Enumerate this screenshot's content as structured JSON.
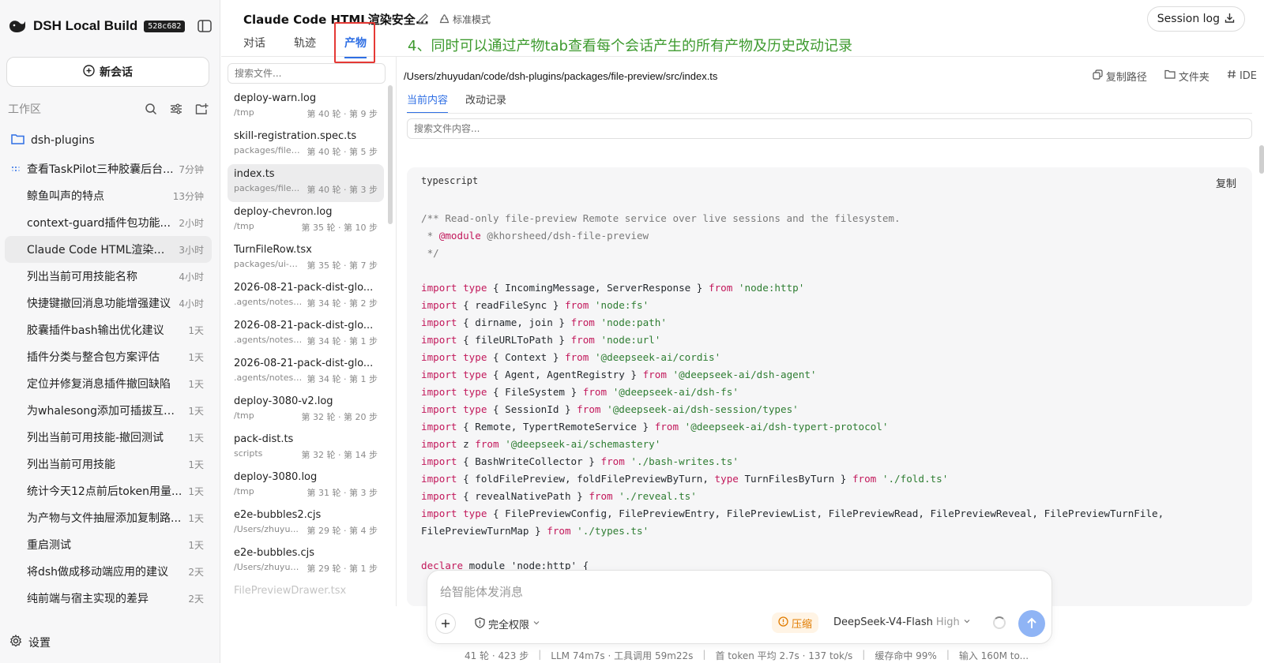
{
  "app": {
    "title": "DSH Local Build",
    "build_id": "528c682"
  },
  "sidebar": {
    "new_chat_label": "新会话",
    "workspace_label": "工作区",
    "folder": "dsh-plugins",
    "sessions": [
      {
        "title": "查看TaskPilot三种胶囊后台...",
        "time": "7分钟",
        "running": true
      },
      {
        "title": "鲸鱼叫声的特点",
        "time": "13分钟"
      },
      {
        "title": "context-guard插件包功能...",
        "time": "2小时"
      },
      {
        "title": "Claude Code HTML渲染安...",
        "time": "3小时",
        "active": true
      },
      {
        "title": "列出当前可用技能名称",
        "time": "4小时"
      },
      {
        "title": "快捷键撤回消息功能增强建议",
        "time": "4小时"
      },
      {
        "title": "胶囊插件bash输出优化建议",
        "time": "1天"
      },
      {
        "title": "插件分类与整合包方案评估",
        "time": "1天"
      },
      {
        "title": "定位并修复消息插件撤回缺陷",
        "time": "1天"
      },
      {
        "title": "为whalesong添加可插拔互动...",
        "time": "1天"
      },
      {
        "title": "列出当前可用技能-撤回测试",
        "time": "1天"
      },
      {
        "title": "列出当前可用技能",
        "time": "1天"
      },
      {
        "title": "统计今天12点前后token用量...",
        "time": "1天"
      },
      {
        "title": "为产物与文件抽屉添加复制路...",
        "time": "1天"
      },
      {
        "title": "重启测试",
        "time": "1天"
      },
      {
        "title": "将dsh做成移动端应用的建议",
        "time": "2天"
      },
      {
        "title": "纯前端与宿主实现的差异",
        "time": "2天"
      }
    ],
    "settings_label": "设置"
  },
  "header": {
    "conversation_title": "Claude Code HTML渲染安全...",
    "mode_label": "标准模式",
    "tabs": [
      {
        "label": "对话"
      },
      {
        "label": "轨迹"
      },
      {
        "label": "产物",
        "active": true
      }
    ],
    "annotation": "4、同时可以通过产物tab查看每个会话产生的所有产物及历史改动记录",
    "session_log_label": "Session log"
  },
  "files": {
    "search_placeholder": "搜索文件...",
    "items": [
      {
        "name": "deploy-warn.log",
        "path": "/tmp",
        "turn": "第 40 轮 · 第 9 步"
      },
      {
        "name": "skill-registration.spec.ts",
        "path": "packages/file-...",
        "turn": "第 40 轮 · 第 5 步"
      },
      {
        "name": "index.ts",
        "path": "packages/file...",
        "turn": "第 40 轮 · 第 3 步",
        "active": true
      },
      {
        "name": "deploy-chevron.log",
        "path": "/tmp",
        "turn": "第 35 轮 · 第 10 步"
      },
      {
        "name": "TurnFileRow.tsx",
        "path": "packages/ui-fi...",
        "turn": "第 35 轮 · 第 7 步"
      },
      {
        "name": "2026-08-21-pack-dist-glo...",
        "path": ".agents/notes/...",
        "turn": "第 34 轮 · 第 2 步"
      },
      {
        "name": "2026-08-21-pack-dist-glo...",
        "path": ".agents/notes/...",
        "turn": "第 34 轮 · 第 1 步"
      },
      {
        "name": "2026-08-21-pack-dist-glo...",
        "path": ".agents/notes/...",
        "turn": "第 34 轮 · 第 1 步"
      },
      {
        "name": "deploy-3080-v2.log",
        "path": "/tmp",
        "turn": "第 32 轮 · 第 20 步"
      },
      {
        "name": "pack-dist.ts",
        "path": "scripts",
        "turn": "第 32 轮 · 第 14 步"
      },
      {
        "name": "deploy-3080.log",
        "path": "/tmp",
        "turn": "第 31 轮 · 第 3 步"
      },
      {
        "name": "e2e-bubbles2.cjs",
        "path": "/Users/zhuyu...",
        "turn": "第 29 轮 · 第 4 步"
      },
      {
        "name": "e2e-bubbles.cjs",
        "path": "/Users/zhuyud...",
        "turn": "第 29 轮 · 第 1 步"
      },
      {
        "name": "FilePreviewDrawer.tsx",
        "path": "",
        "turn": "",
        "faded": true
      }
    ]
  },
  "preview": {
    "file_path": "/Users/zhuyudan/code/dsh-plugins/packages/file-preview/src/index.ts",
    "actions": {
      "copy_path": "复制路径",
      "folder": "文件夹",
      "ide": "IDE"
    },
    "tabs": [
      {
        "label": "当前内容",
        "active": true
      },
      {
        "label": "改动记录"
      }
    ],
    "search_placeholder": "搜索文件内容...",
    "code_language": "typescript",
    "copy_label": "复制",
    "code_lines": [
      [
        {
          "t": "/** Read-only file-preview Remote service over live sessions and the filesystem.",
          "c": "cm"
        }
      ],
      [
        {
          "t": " * ",
          "c": "cm"
        },
        {
          "t": "@module",
          "c": "kw"
        },
        {
          "t": " @khorsheed/dsh-file-preview",
          "c": "cm"
        }
      ],
      [
        {
          "t": " */",
          "c": "cm"
        }
      ],
      [
        {
          "t": ""
        }
      ],
      [
        {
          "t": "import",
          "c": "kw"
        },
        {
          "t": " "
        },
        {
          "t": "type",
          "c": "kw"
        },
        {
          "t": " { IncomingMessage, ServerResponse } "
        },
        {
          "t": "from",
          "c": "kw"
        },
        {
          "t": " "
        },
        {
          "t": "'node:http'",
          "c": "str"
        }
      ],
      [
        {
          "t": "import",
          "c": "kw"
        },
        {
          "t": " { readFileSync } "
        },
        {
          "t": "from",
          "c": "kw"
        },
        {
          "t": " "
        },
        {
          "t": "'node:fs'",
          "c": "str"
        }
      ],
      [
        {
          "t": "import",
          "c": "kw"
        },
        {
          "t": " { dirname, join } "
        },
        {
          "t": "from",
          "c": "kw"
        },
        {
          "t": " "
        },
        {
          "t": "'node:path'",
          "c": "str"
        }
      ],
      [
        {
          "t": "import",
          "c": "kw"
        },
        {
          "t": " { fileURLToPath } "
        },
        {
          "t": "from",
          "c": "kw"
        },
        {
          "t": " "
        },
        {
          "t": "'node:url'",
          "c": "str"
        }
      ],
      [
        {
          "t": "import",
          "c": "kw"
        },
        {
          "t": " "
        },
        {
          "t": "type",
          "c": "kw"
        },
        {
          "t": " { Context } "
        },
        {
          "t": "from",
          "c": "kw"
        },
        {
          "t": " "
        },
        {
          "t": "'@deepseek-ai/cordis'",
          "c": "str"
        }
      ],
      [
        {
          "t": "import",
          "c": "kw"
        },
        {
          "t": " "
        },
        {
          "t": "type",
          "c": "kw"
        },
        {
          "t": " { Agent, AgentRegistry } "
        },
        {
          "t": "from",
          "c": "kw"
        },
        {
          "t": " "
        },
        {
          "t": "'@deepseek-ai/dsh-agent'",
          "c": "str"
        }
      ],
      [
        {
          "t": "import",
          "c": "kw"
        },
        {
          "t": " "
        },
        {
          "t": "type",
          "c": "kw"
        },
        {
          "t": " { FileSystem } "
        },
        {
          "t": "from",
          "c": "kw"
        },
        {
          "t": " "
        },
        {
          "t": "'@deepseek-ai/dsh-fs'",
          "c": "str"
        }
      ],
      [
        {
          "t": "import",
          "c": "kw"
        },
        {
          "t": " "
        },
        {
          "t": "type",
          "c": "kw"
        },
        {
          "t": " { SessionId } "
        },
        {
          "t": "from",
          "c": "kw"
        },
        {
          "t": " "
        },
        {
          "t": "'@deepseek-ai/dsh-session/types'",
          "c": "str"
        }
      ],
      [
        {
          "t": "import",
          "c": "kw"
        },
        {
          "t": " { Remote, TypertRemoteService } "
        },
        {
          "t": "from",
          "c": "kw"
        },
        {
          "t": " "
        },
        {
          "t": "'@deepseek-ai/dsh-typert-protocol'",
          "c": "str"
        }
      ],
      [
        {
          "t": "import",
          "c": "kw"
        },
        {
          "t": " z "
        },
        {
          "t": "from",
          "c": "kw"
        },
        {
          "t": " "
        },
        {
          "t": "'@deepseek-ai/schemastery'",
          "c": "str"
        }
      ],
      [
        {
          "t": "import",
          "c": "kw"
        },
        {
          "t": " { BashWriteCollector } "
        },
        {
          "t": "from",
          "c": "kw"
        },
        {
          "t": " "
        },
        {
          "t": "'./bash-writes.ts'",
          "c": "str"
        }
      ],
      [
        {
          "t": "import",
          "c": "kw"
        },
        {
          "t": " { foldFilePreview, foldFilePreviewByTurn, "
        },
        {
          "t": "type",
          "c": "kw"
        },
        {
          "t": " TurnFilesByTurn } "
        },
        {
          "t": "from",
          "c": "kw"
        },
        {
          "t": " "
        },
        {
          "t": "'./fold.ts'",
          "c": "str"
        }
      ],
      [
        {
          "t": "import",
          "c": "kw"
        },
        {
          "t": " { revealNativePath } "
        },
        {
          "t": "from",
          "c": "kw"
        },
        {
          "t": " "
        },
        {
          "t": "'./reveal.ts'",
          "c": "str"
        }
      ],
      [
        {
          "t": "import",
          "c": "kw"
        },
        {
          "t": " "
        },
        {
          "t": "type",
          "c": "kw"
        },
        {
          "t": " { FilePreviewConfig, FilePreviewEntry, FilePreviewList, FilePreviewRead, FilePreviewReveal, FilePreviewTurnFile, FilePreviewTurnMap } "
        },
        {
          "t": "from",
          "c": "kw"
        },
        {
          "t": " "
        },
        {
          "t": "'./types.ts'",
          "c": "str"
        }
      ],
      [
        {
          "t": ""
        }
      ],
      [
        {
          "t": "declare",
          "c": "kw"
        },
        {
          "t": " module 'node:http' {"
        }
      ]
    ]
  },
  "composer": {
    "placeholder": "给智能体发消息",
    "permission_label": "完全权限",
    "compress_label": "压缩",
    "model_name": "DeepSeek-V4-Flash",
    "model_level": "High"
  },
  "statusbar": {
    "items": [
      "41 轮 · 423 步",
      "LLM 74m7s · 工具调用 59m22s",
      "首 token 平均 2.7s · 137 tok/s",
      "缓存命中 99%",
      "输入 160M to..."
    ]
  },
  "colors": {
    "accent": "#2f6fe4",
    "annotation": "#3d9a2e",
    "highlight_box": "#e53935",
    "compress": "#e07b00"
  }
}
